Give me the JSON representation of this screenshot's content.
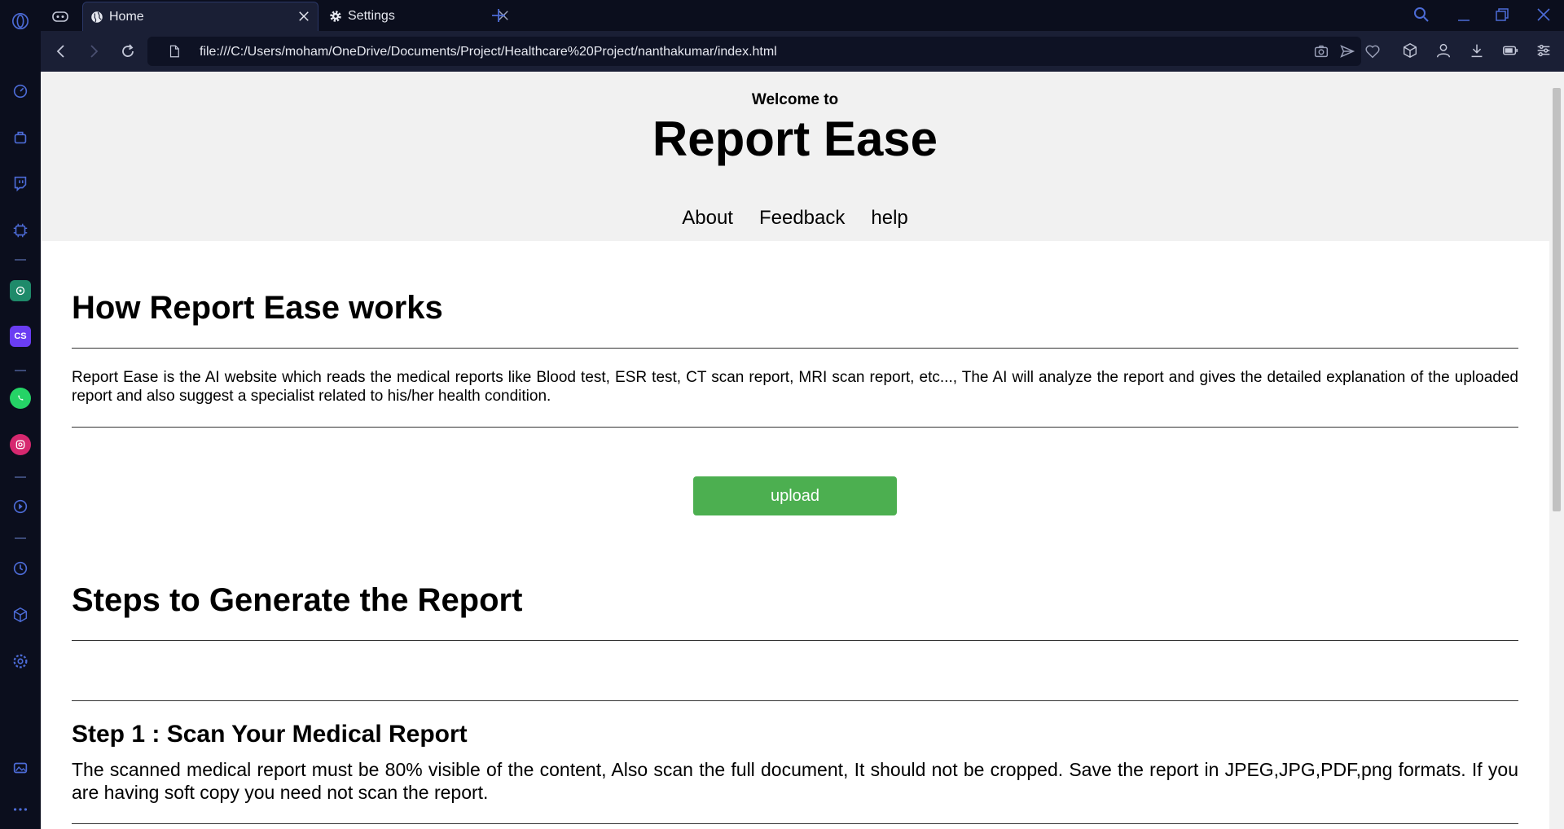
{
  "browser": {
    "tabs": [
      {
        "label": "Home",
        "active": true
      },
      {
        "label": "Settings",
        "active": false
      }
    ],
    "url": "file:///C:/Users/moham/OneDrive/Documents/Project/Healthcare%20Project/nanthakumar/index.html"
  },
  "colors": {
    "browser_bg": "#0b0e1d",
    "toolbar_bg": "#1a1f35",
    "accent": "#4c8bf5",
    "upload_button": "#4caf50",
    "header_bg": "#f1f1f1"
  },
  "page": {
    "header": {
      "welcome": "Welcome to",
      "brand": "Report Ease",
      "nav": [
        "About",
        "Feedback",
        "help"
      ]
    },
    "how_it_works": {
      "title": "How Report Ease works",
      "description": "Report Ease is the AI website which reads the medical reports like Blood test, ESR test, CT scan report, MRI scan report, etc..., The AI will analyze the report and gives the detailed explanation of the uploaded report and also suggest a specialist related to his/her health condition."
    },
    "upload_label": "upload",
    "steps": {
      "title": "Steps to Generate the Report",
      "items": [
        {
          "title": "Step 1 : Scan Your Medical Report",
          "text": "The scanned medical report must be 80% visible of the content, Also scan the full document, It should not be cropped. Save the report in JPEG,JPG,PDF,png formats. If you are having soft copy you need not scan the report."
        }
      ]
    }
  }
}
